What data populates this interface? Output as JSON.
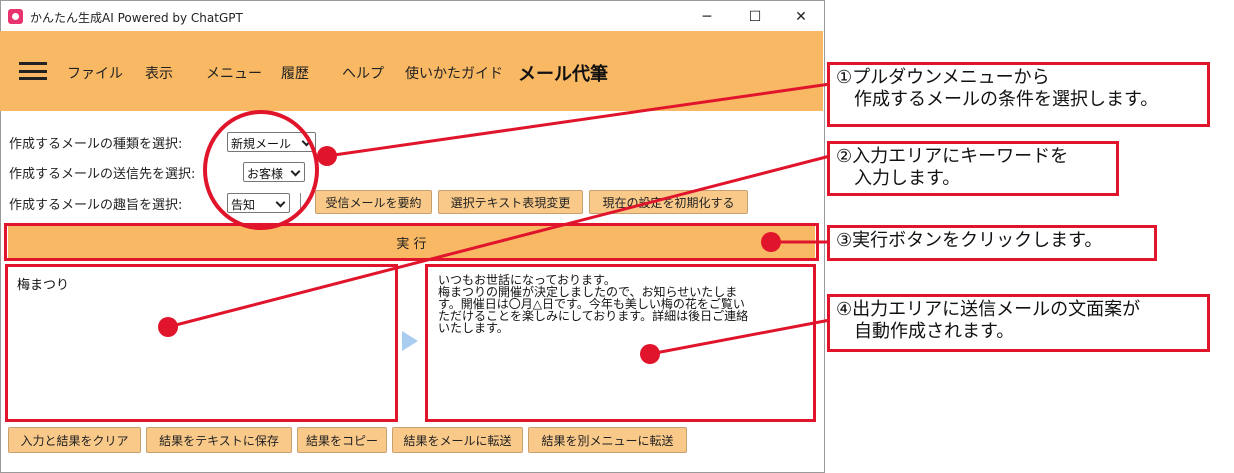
{
  "window": {
    "title": "かんたん生成AI Powered by ChatGPT",
    "controls": {
      "minimize": "─",
      "maximize": "☐",
      "close": "✕"
    }
  },
  "menubar": {
    "items": [
      "ファイル",
      "表示",
      "メニュー",
      "履歴",
      "ヘルプ",
      "使いかたガイド"
    ],
    "page_title": "メール代筆"
  },
  "form": {
    "type_label": "作成するメールの種類を選択:",
    "type_value": "新規メール",
    "recipient_label": "作成するメールの送信先を選択:",
    "recipient_value": "お客様",
    "purpose_label": "作成するメールの趣旨を選択:",
    "purpose_value": "告知",
    "summarize_button": "受信メールを要約",
    "rephrase_button": "選択テキスト表現変更",
    "reset_button": "現在の設定を初期化する"
  },
  "run_button": "実 行",
  "input_text": "梅まつり",
  "output_lines": [
    "いつもお世話になっております。",
    "梅まつりの開催が決定しましたので、お知らせいたしま",
    "す。開催日は〇月△日です。今年も美しい梅の花をご覧い",
    "ただけることを楽しみにしております。詳細は後日ご連絡",
    "いたします。"
  ],
  "bottom_buttons": [
    "入力と結果をクリア",
    "結果をテキストに保存",
    "結果をコピー",
    "結果をメールに転送",
    "結果を別メニューに転送"
  ],
  "callouts": [
    "①プルダウンメニューから\n　作成するメールの条件を選択します。",
    "②入力エリアにキーワードを\n　入力します。",
    "③実行ボタンをクリックします。",
    "④出力エリアに送信メールの文面案が\n　自動作成されます。"
  ],
  "colors": {
    "accent": "#f9b864",
    "button": "#f9c98a",
    "annotation": "#e0152c"
  }
}
